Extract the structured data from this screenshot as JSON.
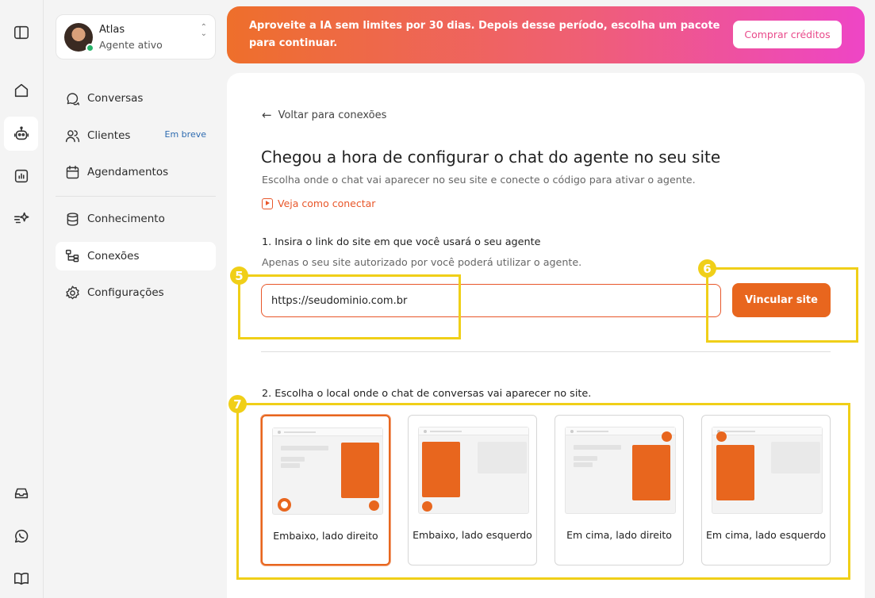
{
  "rail": {
    "items": [
      {
        "icon": "sidebar-toggle-icon"
      },
      {
        "icon": "home-icon"
      },
      {
        "icon": "robot-icon",
        "active": true
      },
      {
        "icon": "chart-icon"
      },
      {
        "icon": "sparkle-icon"
      },
      {
        "icon": "inbox-icon"
      },
      {
        "icon": "whatsapp-icon"
      },
      {
        "icon": "book-icon"
      }
    ]
  },
  "agent": {
    "name": "Atlas",
    "status": "Agente ativo",
    "status_color": "#27b36a"
  },
  "sidebar": {
    "items": [
      {
        "label": "Conversas",
        "icon": "chat-icon"
      },
      {
        "label": "Clientes",
        "icon": "users-icon",
        "badge": "Em breve"
      },
      {
        "label": "Agendamentos",
        "icon": "calendar-icon"
      },
      {
        "label": "Conhecimento",
        "icon": "database-icon"
      },
      {
        "label": "Conexões",
        "icon": "connections-icon",
        "active": true
      },
      {
        "label": "Configurações",
        "icon": "gear-icon"
      }
    ]
  },
  "banner": {
    "text": "Aproveite a IA sem limites por 30 dias. Depois desse período, escolha um pacote para continuar.",
    "button": "Comprar créditos"
  },
  "content": {
    "back": "Voltar para conexões",
    "title": "Chegou a hora de configurar o chat do agente no seu site",
    "subtitle": "Escolha onde o chat vai aparecer no seu site e conecte o código para ativar o agente.",
    "how_to_link": "Veja como conectar",
    "step1": {
      "title": "1. Insira o link do site em que você usará o seu agente",
      "subtitle": "Apenas o seu site autorizado por você poderá utilizar o agente.",
      "input_value": "https://seudominio.com.br",
      "button": "Vincular site"
    },
    "step2": {
      "title": "2. Escolha o local onde o chat de conversas vai aparecer no site.",
      "options": [
        {
          "label": "Embaixo, lado direito",
          "selected": true
        },
        {
          "label": "Embaixo, lado esquerdo"
        },
        {
          "label": "Em cima, lado direito"
        },
        {
          "label": "Em cima, lado esquerdo"
        }
      ]
    }
  },
  "annotations": [
    "5",
    "6",
    "7"
  ],
  "colors": {
    "accent": "#e8661e",
    "annotation": "#f0cf18",
    "link": "#e8572a",
    "badge": "#2e6bb0"
  }
}
